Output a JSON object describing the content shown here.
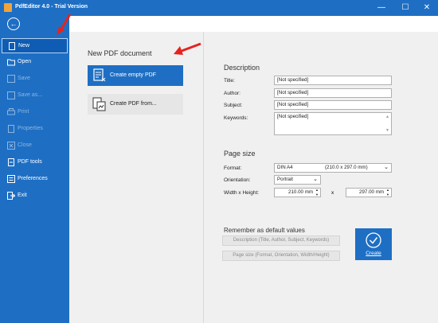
{
  "window": {
    "title": "PdfEditor 4.0 - Trial Version",
    "minimize": "—",
    "maximize": "☐",
    "close": "✕"
  },
  "sidebar": {
    "back": "←",
    "items": [
      {
        "label": "New"
      },
      {
        "label": "Open"
      },
      {
        "label": "Save"
      },
      {
        "label": "Save as..."
      },
      {
        "label": "Print"
      },
      {
        "label": "Properties"
      },
      {
        "label": "Close"
      },
      {
        "label": "PDF tools"
      },
      {
        "label": "Preferences"
      },
      {
        "label": "Exit"
      }
    ]
  },
  "new_pdf": {
    "title": "New PDF document",
    "create_empty": "Create empty PDF",
    "create_from": "Create PDF from..."
  },
  "description": {
    "title": "Description",
    "title_label": "Title:",
    "title_value": "[Not specified]",
    "author_label": "Author:",
    "author_value": "[Not specified]",
    "subject_label": "Subject:",
    "subject_value": "[Not specified]",
    "keywords_label": "Keywords:",
    "keywords_value": "[Not specified]"
  },
  "page_size": {
    "title": "Page size",
    "format_label": "Format:",
    "format_value": "DIN A4",
    "format_dims": "(210.0 x 297.0 mm)",
    "orientation_label": "Orientation:",
    "orientation_value": "Portrait",
    "wh_label": "Width x Height:",
    "width_value": "210.00 mm",
    "x_sep": "x",
    "height_value": "297.00 mm"
  },
  "defaults": {
    "title": "Remember as default values",
    "btn_description": "Description (Title, Author, Subject, Keywords)",
    "btn_pagesize": "Page size (Format, Orientation, Width/Height)"
  },
  "create": {
    "label": "Create"
  },
  "colors": {
    "accent": "#1e6fc4",
    "arrow": "#e5231e"
  }
}
